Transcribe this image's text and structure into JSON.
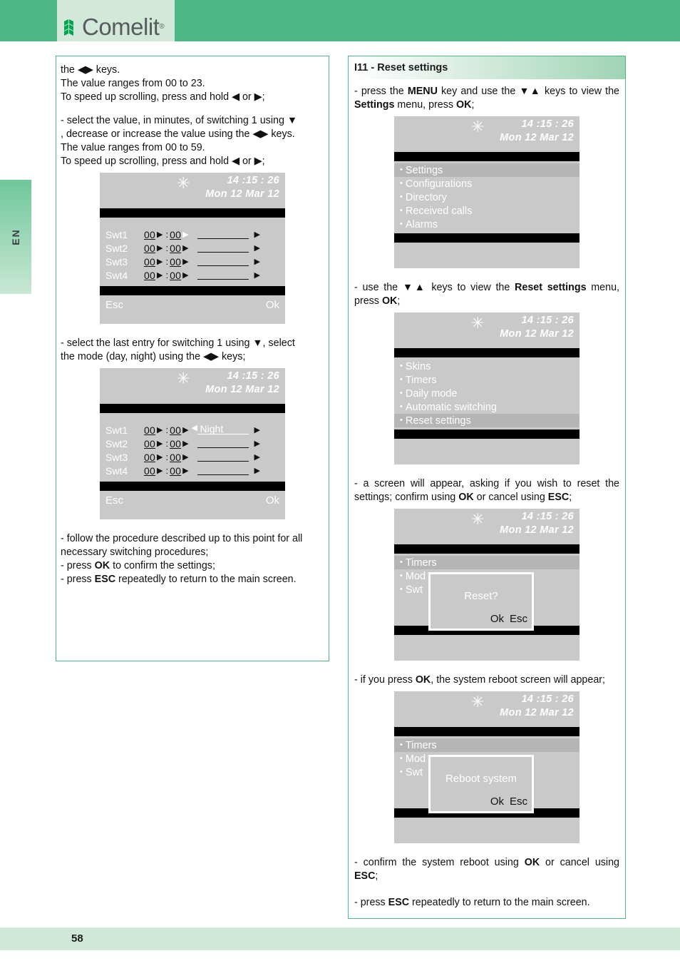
{
  "brand": {
    "name": "Comelit",
    "reg": "®"
  },
  "side_tab": {
    "label": "EN"
  },
  "footer": {
    "page_number": "58"
  },
  "colors": {
    "header_green": "#4cb784",
    "logo_box": "#d2e8d8",
    "footer_green": "#cfe8d7",
    "border_green": "#4cb784",
    "screen_gray": "#c9c9c9",
    "screen_highlight": "#b5b5b5",
    "screen_bar": "#000000"
  },
  "left_column": {
    "para1_line1": "the ◀▶ keys.",
    "para1_line2": "The value ranges from 00 to 23.",
    "para1_line3": "To speed up scrolling, press and hold ◀ or ▶;",
    "para2_line1": "- select the value, in minutes, of switching 1 using ▼",
    "para2_line2": ", decrease or increase the value using the ◀▶ keys.",
    "para2_line3": "The value ranges from 00 to 59.",
    "para2_line4": "To speed up scrolling, press and hold ◀ or ▶;",
    "para3_line1": "- select the last entry for switching 1 using ▼, select",
    "para3_line2": "the mode (day, night) using the ◀▶ keys;",
    "para4_line1": "- follow the procedure described up to this point for all",
    "para4_line2": "necessary switching procedures;",
    "para4_line3_a": "- press ",
    "para4_line3_b": "OK",
    "para4_line3_c": " to confirm the settings;",
    "para4_line4_a": "- press ",
    "para4_line4_b": "ESC",
    "para4_line4_c": " repeatedly to return to the main screen."
  },
  "screen_common": {
    "time": "14 :15 : 26",
    "date": "Mon 12 Mar 12",
    "star_icon": "✳",
    "esc_label": "Esc",
    "ok_label": "Ok"
  },
  "screen_swt_plain": {
    "rows": [
      {
        "label": "Swt1",
        "hours": "00",
        "minutes": "00",
        "mode": ""
      },
      {
        "label": "Swt2",
        "hours": "00",
        "minutes": "00",
        "mode": ""
      },
      {
        "label": "Swt3",
        "hours": "00",
        "minutes": "00",
        "mode": ""
      },
      {
        "label": "Swt4",
        "hours": "00",
        "minutes": "00",
        "mode": ""
      }
    ]
  },
  "screen_swt_night": {
    "rows": [
      {
        "label": "Swt1",
        "hours": "00",
        "minutes": "00",
        "mode": "Night"
      },
      {
        "label": "Swt2",
        "hours": "00",
        "minutes": "00",
        "mode": ""
      },
      {
        "label": "Swt3",
        "hours": "00",
        "minutes": "00",
        "mode": ""
      },
      {
        "label": "Swt4",
        "hours": "00",
        "minutes": "00",
        "mode": ""
      }
    ]
  },
  "right_column": {
    "section_title": "I11 - Reset settings",
    "step1_a": "- press the ",
    "step1_b": "MENU",
    "step1_c": " key and use the ▼▲ keys to view the ",
    "step1_d": "Settings",
    "step1_e": " menu, press ",
    "step1_f": "OK",
    "step1_g": ";",
    "step2_a": "- use the ▼▲ keys to view the ",
    "step2_b": "Reset settings",
    "step2_c": " menu, press ",
    "step2_d": "OK",
    "step2_e": ";",
    "step3_a": "- a screen will appear, asking if you wish to reset the settings; confirm using ",
    "step3_b": "OK",
    "step3_c": " or cancel using ",
    "step3_d": "ESC",
    "step3_e": ";",
    "step4_a": "- if you press ",
    "step4_b": "OK",
    "step4_c": ", the system reboot screen will appear;",
    "step5_a": "- confirm the system reboot using ",
    "step5_b": "OK",
    "step5_c": " or cancel using ",
    "step5_d": "ESC",
    "step5_e": ";",
    "step6_a": "- press ",
    "step6_b": "ESC",
    "step6_c": " repeatedly to return to the main screen."
  },
  "screen_main_menu": {
    "items": [
      {
        "label": "Settings",
        "selected": true
      },
      {
        "label": "Configurations",
        "selected": false
      },
      {
        "label": "Directory",
        "selected": false
      },
      {
        "label": "Received calls",
        "selected": false
      },
      {
        "label": "Alarms",
        "selected": false
      }
    ]
  },
  "screen_settings_menu": {
    "items": [
      {
        "label": "Skins",
        "selected": false
      },
      {
        "label": "Timers",
        "selected": false
      },
      {
        "label": "Daily mode",
        "selected": false
      },
      {
        "label": "Automatic switching",
        "selected": false
      },
      {
        "label": "Reset settings",
        "selected": true
      }
    ]
  },
  "screen_reset_dialog": {
    "items": [
      {
        "label": "Timers",
        "selected": true
      },
      {
        "label": "Mod",
        "selected": false
      },
      {
        "label": "Swt",
        "selected": false
      }
    ],
    "dialog_title": "Reset?",
    "dialog_ok": "Ok",
    "dialog_esc": "Esc"
  },
  "screen_reboot_dialog": {
    "items": [
      {
        "label": "Timers",
        "selected": true
      },
      {
        "label": "Mod",
        "selected": false
      },
      {
        "label": "Swt",
        "selected": false
      }
    ],
    "dialog_title": "Reboot system",
    "dialog_ok": "Ok",
    "dialog_esc": "Esc"
  }
}
